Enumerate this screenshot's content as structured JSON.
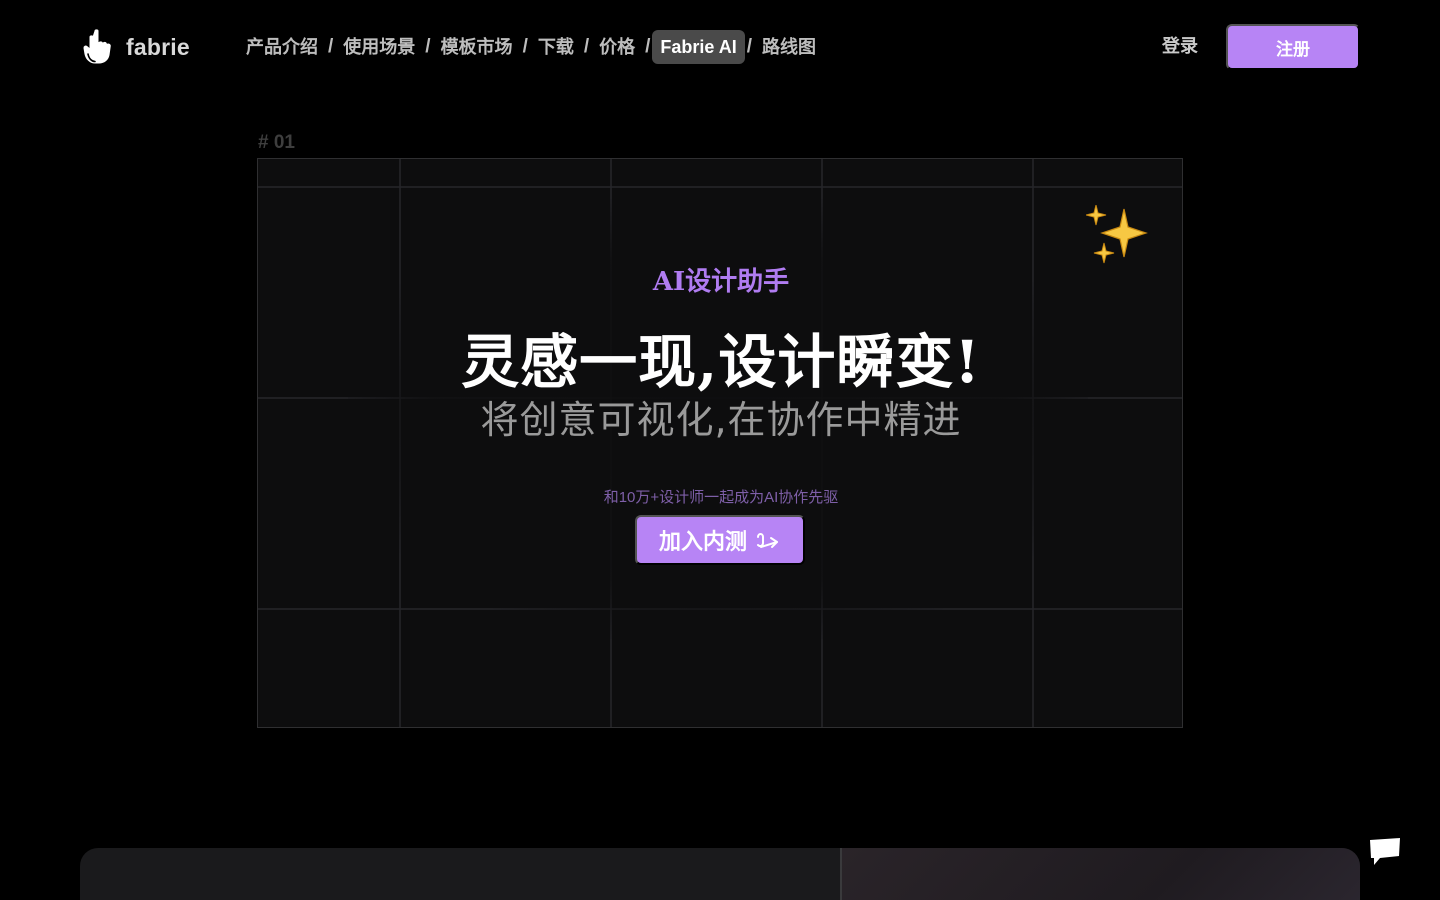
{
  "brand": {
    "name": "fabrie",
    "logo_icon": "pointing-hand-icon"
  },
  "nav": {
    "items": [
      {
        "label": "产品介绍",
        "active": false
      },
      {
        "label": "使用场景",
        "active": false
      },
      {
        "label": "模板市场",
        "active": false
      },
      {
        "label": "下载",
        "active": false
      },
      {
        "label": "价格",
        "active": false
      },
      {
        "label": "Fabrie AI",
        "active": true
      },
      {
        "label": "路线图",
        "active": false
      }
    ],
    "separator": "/",
    "login_label": "登录",
    "signup_label": "注册"
  },
  "hero": {
    "section_number": "# 01",
    "eyebrow": "AI设计助手",
    "headline": "灵感一现,设计瞬变!",
    "subline": "将创意可视化,在协作中精进",
    "social_proof": "和10万+设计师一起成为AI协作先驱",
    "cta_label": "加入内测",
    "cta_icon": "hand-arrow-icon",
    "sparkle_icon": "sparkles-icon"
  },
  "widgets": {
    "chat_icon": "chat-bubble-icon"
  },
  "colors": {
    "background": "#000000",
    "accent": "#b784f5",
    "eyebrow": "#b07cf1",
    "active_nav_bg": "#4a4a4a",
    "card_bg": "#0d0d0e",
    "sparkle": "#f7c843"
  }
}
